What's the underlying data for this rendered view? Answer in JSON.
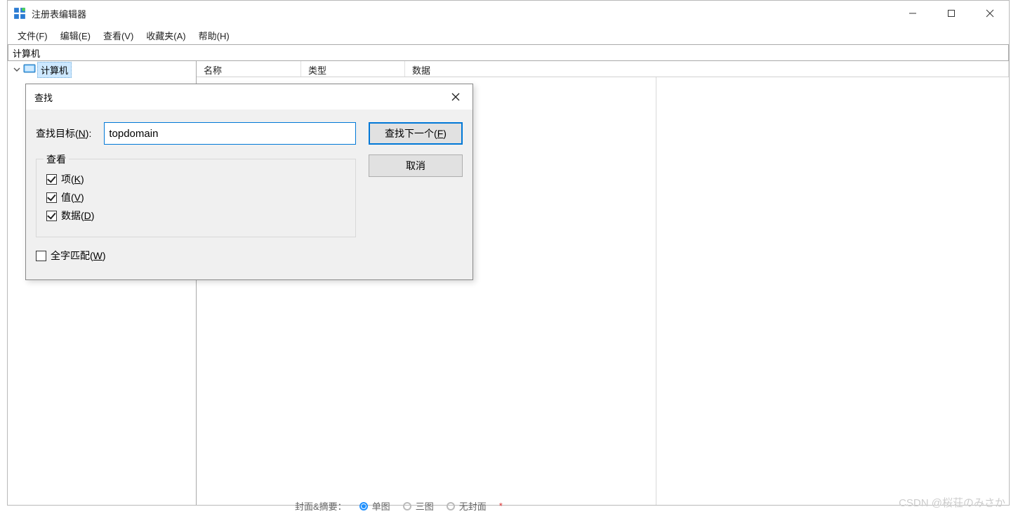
{
  "app": {
    "title": "注册表编辑器"
  },
  "menu": {
    "file": "文件(F)",
    "edit": "编辑(E)",
    "view": "查看(V)",
    "favorites": "收藏夹(A)",
    "help": "帮助(H)"
  },
  "address": {
    "path": "计算机"
  },
  "tree": {
    "root_label": "计算机"
  },
  "columns": {
    "name": "名称",
    "type": "类型",
    "data": "数据"
  },
  "dialog": {
    "title": "查找",
    "find_label": "查找目标(N):",
    "find_value": "topdomain",
    "fieldset_legend": "查看",
    "cb_key": "项(K)",
    "cb_value": "值(V)",
    "cb_data": "数据(D)",
    "cb_whole": "全字匹配(W)",
    "btn_find_next": "查找下一个(F)",
    "btn_cancel": "取消",
    "checked": {
      "key": true,
      "value": true,
      "data": true,
      "whole": false
    }
  },
  "watermark": "CSDN @桜荘のみさか",
  "behind": {
    "label": "封面&摘要：",
    "opt1": "单图",
    "opt2": "三图",
    "opt3": "无封面"
  }
}
